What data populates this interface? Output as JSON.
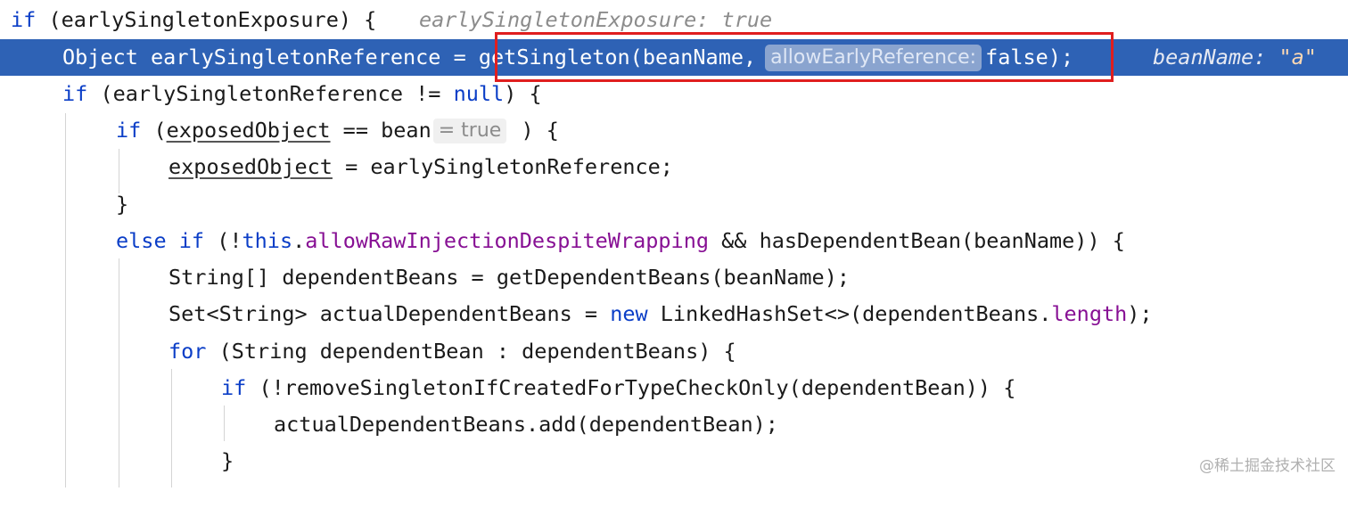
{
  "code": {
    "l1": {
      "kw_if": "if",
      "text": " (earlySingletonExposure) {",
      "hint": "earlySingletonExposure: true"
    },
    "l2": {
      "text_a": "Object earlySingletonReference = ",
      "call": "getSingleton(beanName,",
      "param_hint": "allowEarlyReference:",
      "arg_false": "false)",
      "semicolon": ";",
      "hint_name": "beanName:",
      "hint_value": "\"a\""
    },
    "l3": {
      "kw_if": "if",
      "text_a": " (earlySingletonReference != ",
      "kw_null": "null",
      "text_b": ") {"
    },
    "l4": {
      "kw_if": "if",
      "text_a": " (",
      "var_exposed": "exposedObject",
      "text_b": " == bean",
      "eval": "= true",
      "text_c": " ) {"
    },
    "l5": {
      "var_exposed": "exposedObject",
      "text": " = earlySingletonReference;"
    },
    "l6": {
      "text": "}"
    },
    "l7": {
      "kw_else": "else",
      "kw_if": "if",
      "text_a": " (!",
      "kw_this": "this",
      "dot": ".",
      "field": "allowRawInjectionDespiteWrapping",
      "text_b": " && hasDependentBean(beanName)) {"
    },
    "l8": {
      "text": "String[] dependentBeans = getDependentBeans(beanName);"
    },
    "l9": {
      "text_a": "Set<String> actualDependentBeans = ",
      "kw_new": "new",
      "text_b": " LinkedHashSet<>(dependentBeans.",
      "field": "length",
      "text_c": ");"
    },
    "l10": {
      "kw_for": "for",
      "text": " (String dependentBean : dependentBeans) {"
    },
    "l11": {
      "kw_if": "if",
      "text": " (!removeSingletonIfCreatedForTypeCheckOnly(dependentBean)) {"
    },
    "l12": {
      "text": "actualDependentBeans.add(dependentBean);"
    },
    "l13": {
      "text": "}"
    }
  },
  "watermark": "@稀土掘金技术社区",
  "colors": {
    "keyword": "#0b3ec7",
    "field": "#871094",
    "highlight_line": "#2e62b5",
    "box": "#e01e1e"
  }
}
